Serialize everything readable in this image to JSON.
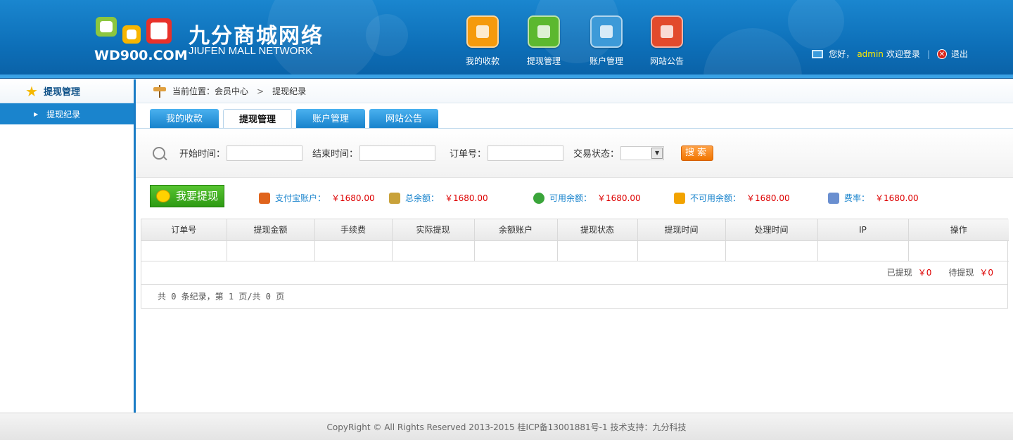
{
  "header": {
    "logo_text": "WD900.COM",
    "brand_cn": "九分商城网络",
    "brand_en": "JIUFEN MALL NETWORK",
    "nav": [
      {
        "label": "我的收款",
        "icon": "wallet-icon",
        "color": "#f59a0c"
      },
      {
        "label": "提现管理",
        "icon": "card-icon",
        "color": "#5cb82f"
      },
      {
        "label": "账户管理",
        "icon": "briefcase-icon",
        "color": "#3d9ad8"
      },
      {
        "label": "网站公告",
        "icon": "notepad-icon",
        "color": "#e24a2c"
      }
    ],
    "greeting": "您好，",
    "username": "admin",
    "welcome": "欢迎登录",
    "separator": "|",
    "logout": "退出"
  },
  "sidebar": {
    "title": "提现管理",
    "items": [
      {
        "label": "提现纪录"
      }
    ]
  },
  "breadcrumb": {
    "prefix": "当前位置：会员中心",
    "sep": ">",
    "current": "提现纪录"
  },
  "tabs": [
    {
      "label": "我的收款",
      "active": false
    },
    {
      "label": "提现管理",
      "active": true
    },
    {
      "label": "账户管理",
      "active": false
    },
    {
      "label": "网站公告",
      "active": false
    }
  ],
  "search": {
    "start_label": "开始时间：",
    "end_label": "结束时间：",
    "order_label": "订单号：",
    "status_label": "交易状态：",
    "start_value": "",
    "end_value": "",
    "order_value": "",
    "status_value": "",
    "button": "搜索"
  },
  "summary": {
    "withdraw_button": "我要提现",
    "stats": [
      {
        "label": "支付宝账户：",
        "value": "￥1680.00",
        "icon": "alipay-icon",
        "color": "#e0641c"
      },
      {
        "label": "总余额：",
        "value": "￥1680.00",
        "icon": "money-stack-icon",
        "color": "#c9a23a"
      },
      {
        "label": "可用余额：",
        "value": "￥1680.00",
        "icon": "check-circle-icon",
        "color": "#3aa53a"
      },
      {
        "label": "不可用余额：",
        "value": "￥1680.00",
        "icon": "warning-icon",
        "color": "#f2a300"
      },
      {
        "label": "费率：",
        "value": "￥1680.00",
        "icon": "chart-icon",
        "color": "#6a8fd0"
      }
    ]
  },
  "table": {
    "columns": [
      "订单号",
      "提现金额",
      "手续费",
      "实际提现",
      "余额账户",
      "提现状态",
      "提现时间",
      "处理时间",
      "IP",
      "操作"
    ],
    "rows": [
      [
        "",
        "",
        "",
        "",
        "",
        "",
        "",
        "",
        "",
        ""
      ]
    ],
    "withdrawn_label": "已提现",
    "withdrawn_value": "￥0",
    "pending_label": "待提现",
    "pending_value": "￥0",
    "pager": "共 0 条纪录，第 1 页/共 0 页"
  },
  "footer": {
    "text": "CopyRight © All Rights Reserved 2013-2015  桂ICP备13001881号-1    技术支持：九分科技"
  }
}
